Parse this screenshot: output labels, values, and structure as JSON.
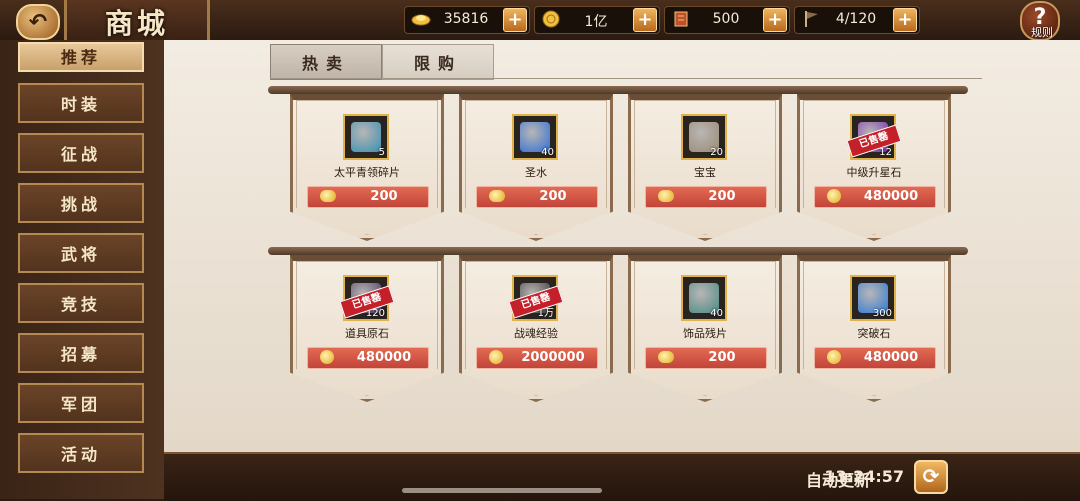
{
  "header": {
    "back_icon": "back-arrow-icon",
    "title": "商城",
    "resources": [
      {
        "icon": "gold-ingot-icon",
        "value": "35816"
      },
      {
        "icon": "coin-icon",
        "value": "1亿"
      },
      {
        "icon": "token-icon",
        "value": "500"
      },
      {
        "icon": "banner-icon",
        "value": "4/120"
      }
    ],
    "help_icon": "question-icon",
    "help_label": "规则"
  },
  "sidebar": {
    "items": [
      {
        "label": "推荐"
      },
      {
        "label": "时装"
      },
      {
        "label": "征战"
      },
      {
        "label": "挑战"
      },
      {
        "label": "武将"
      },
      {
        "label": "竞技"
      },
      {
        "label": "招募"
      },
      {
        "label": "军团"
      },
      {
        "label": "活动"
      }
    ]
  },
  "tabs": [
    {
      "label": "热卖"
    },
    {
      "label": "限购"
    }
  ],
  "items": [
    {
      "name": "太平青领碎片",
      "count": "5",
      "price": "200",
      "currency": "gold-ingot-icon",
      "sold": "",
      "color": "#3a8fb3"
    },
    {
      "name": "圣水",
      "count": "40",
      "price": "200",
      "currency": "gold-ingot-icon",
      "sold": "",
      "color": "#2f6fd6"
    },
    {
      "name": "宝宝",
      "count": "20",
      "price": "200",
      "currency": "gold-ingot-icon",
      "sold": "",
      "color": "#9b8a73"
    },
    {
      "name": "中级升星石",
      "count": "12",
      "price": "480000",
      "currency": "coin-icon",
      "sold": "已售罄",
      "color": "#7a2bb0"
    },
    {
      "name": "道具原石",
      "count": "120",
      "price": "480000",
      "currency": "coin-icon",
      "sold": "已售罄",
      "color": "#4b3a5e"
    },
    {
      "name": "战魂经验",
      "count": "1万",
      "price": "2000000",
      "currency": "coin-icon",
      "sold": "已售罄",
      "color": "#3a3a3a"
    },
    {
      "name": "饰品残片",
      "count": "40",
      "price": "200",
      "currency": "gold-ingot-icon",
      "sold": "",
      "color": "#4a8a84"
    },
    {
      "name": "突破石",
      "count": "300",
      "price": "480000",
      "currency": "coin-icon",
      "sold": "",
      "color": "#2f7ad6"
    }
  ],
  "footer": {
    "refresh_label": "自动更新",
    "refresh_time": "13:24:57",
    "refresh_icon": "refresh-icon"
  }
}
